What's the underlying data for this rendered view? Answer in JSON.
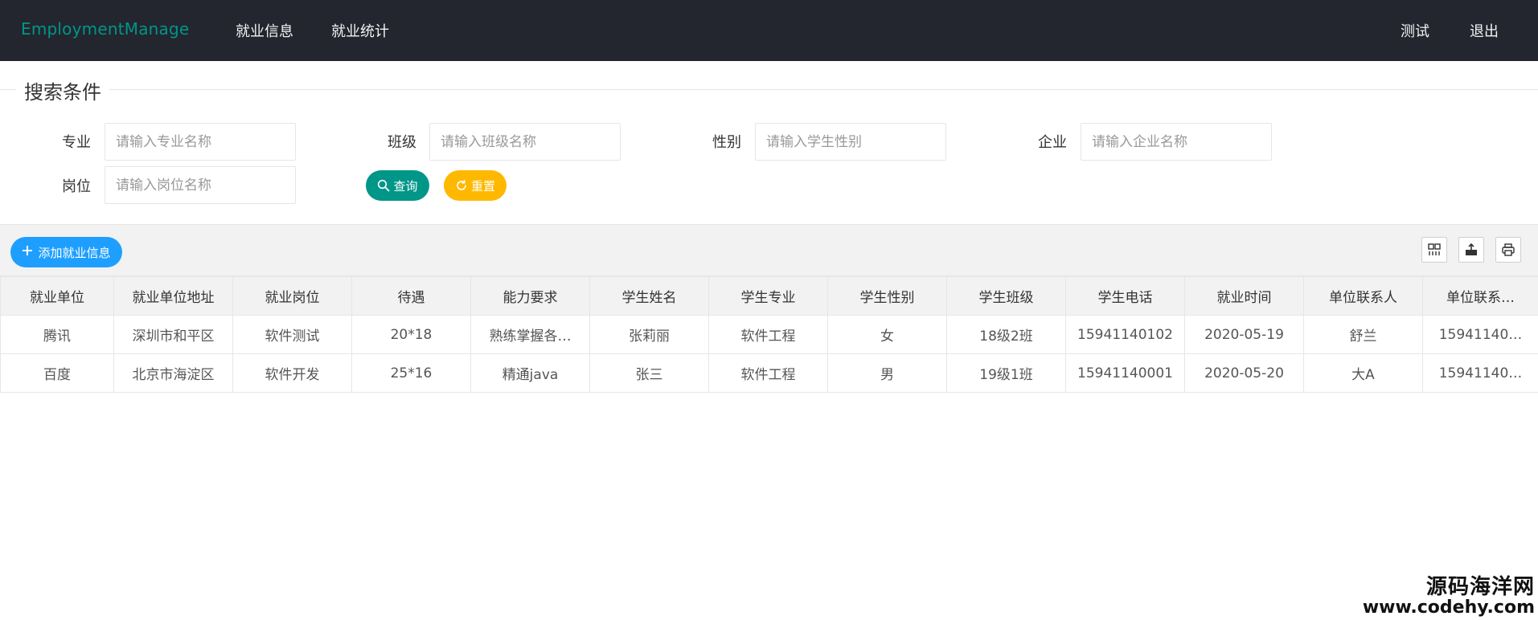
{
  "header": {
    "logo": "EmploymentManage",
    "nav": [
      "就业信息",
      "就业统计"
    ],
    "right_nav": [
      "测试",
      "退出"
    ]
  },
  "search": {
    "legend": "搜索条件",
    "fields": [
      {
        "label": "专业",
        "placeholder": "请输入专业名称"
      },
      {
        "label": "班级",
        "placeholder": "请输入班级名称"
      },
      {
        "label": "性别",
        "placeholder": "请输入学生性别"
      },
      {
        "label": "企业",
        "placeholder": "请输入企业名称"
      },
      {
        "label": "岗位",
        "placeholder": "请输入岗位名称"
      }
    ],
    "search_label": "查询",
    "reset_label": "重置"
  },
  "toolbar": {
    "add_label": "添加就业信息",
    "icons": [
      "columns-icon",
      "export-icon",
      "print-icon"
    ]
  },
  "table": {
    "columns": [
      "就业单位",
      "就业单位地址",
      "就业岗位",
      "待遇",
      "能力要求",
      "学生姓名",
      "学生专业",
      "学生性别",
      "学生班级",
      "学生电话",
      "就业时间",
      "单位联系人",
      "单位联系…"
    ],
    "rows": [
      [
        "腾讯",
        "深圳市和平区",
        "软件测试",
        "20*18",
        "熟练掌握各…",
        "张莉丽",
        "软件工程",
        "女",
        "18级2班",
        "15941140102",
        "2020-05-19",
        "舒兰",
        "15941140…"
      ],
      [
        "百度",
        "北京市海淀区",
        "软件开发",
        "25*16",
        "精通java",
        "张三",
        "软件工程",
        "男",
        "19级1班",
        "15941140001",
        "2020-05-20",
        "大A",
        "15941140…"
      ]
    ]
  },
  "watermark": {
    "cn": "源码海洋网",
    "url": "www.codehy.com"
  },
  "colors": {
    "header_bg": "#23262e",
    "logo": "#009688",
    "search_btn": "#009688",
    "reset_btn": "#ffb800",
    "add_btn": "#1e9fff"
  }
}
